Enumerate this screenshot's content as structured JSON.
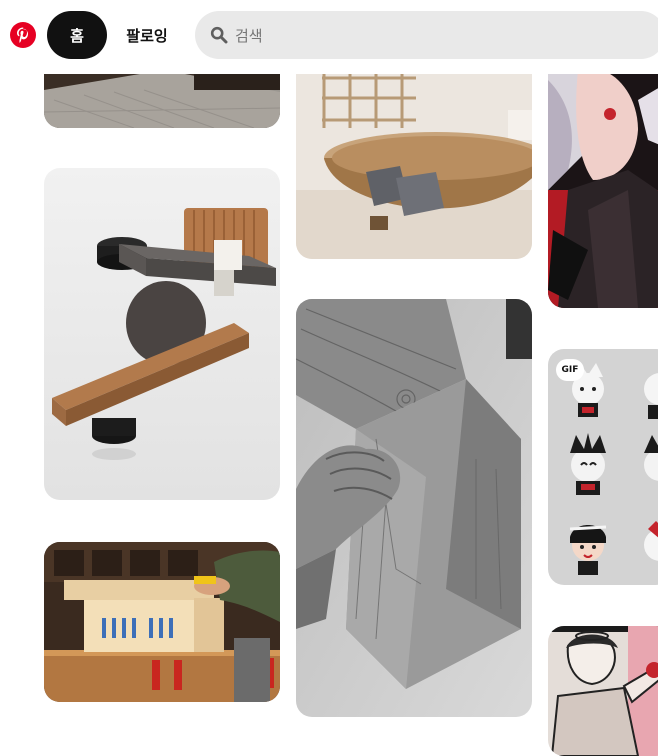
{
  "header": {
    "logo_icon": "pinterest-logo-icon",
    "brand_color": "#e60023",
    "nav": {
      "home_label": "홈",
      "following_label": "팔로잉"
    },
    "search": {
      "placeholder": "검색",
      "icon": "search-icon"
    }
  },
  "feed": {
    "gif_badge": "GIF",
    "pins": [
      {
        "id": "bedroom-floor-pin",
        "column": 1
      },
      {
        "id": "lounge-chair-pin",
        "column": 2
      },
      {
        "id": "anime-character-pin",
        "column": 3
      },
      {
        "id": "modern-benches-pin",
        "column": 1
      },
      {
        "id": "wood-joinery-pin",
        "column": 2
      },
      {
        "id": "gif-stickers-pin",
        "column": 3
      },
      {
        "id": "router-table-pin",
        "column": 1
      },
      {
        "id": "manga-drawing-pin",
        "column": 3
      }
    ]
  }
}
